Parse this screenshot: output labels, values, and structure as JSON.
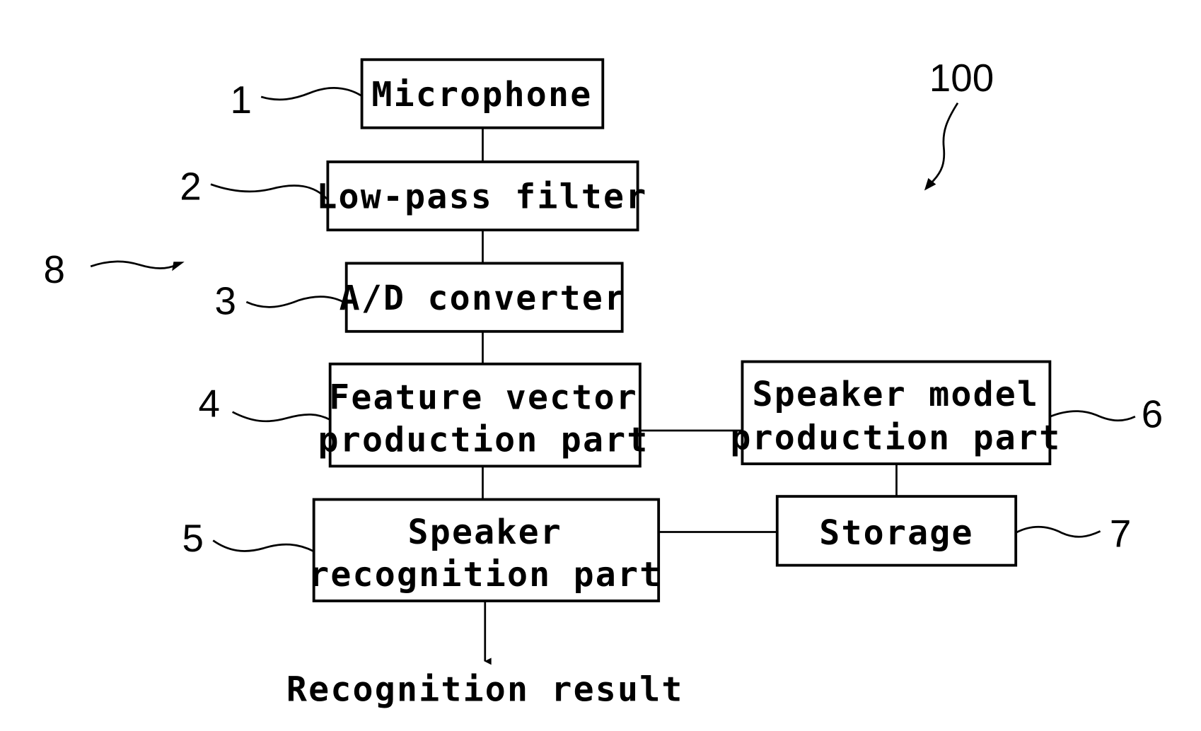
{
  "figure": {
    "reference_numeral": "100",
    "group_numeral": "8"
  },
  "blocks": {
    "microphone": {
      "numeral": "1",
      "lines": [
        "Microphone"
      ]
    },
    "low_pass_filter": {
      "numeral": "2",
      "lines": [
        "Low-pass filter"
      ]
    },
    "ad_converter": {
      "numeral": "3",
      "lines": [
        "A/D converter"
      ]
    },
    "feature_vector": {
      "numeral": "4",
      "lines": [
        "Feature vector",
        "production part"
      ]
    },
    "speaker_recognition": {
      "numeral": "5",
      "lines": [
        "Speaker",
        "recognition part"
      ]
    },
    "speaker_model": {
      "numeral": "6",
      "lines": [
        "Speaker model",
        "production part"
      ]
    },
    "storage": {
      "numeral": "7",
      "lines": [
        "Storage"
      ]
    }
  },
  "output": {
    "label": "Recognition result"
  },
  "connections": [
    [
      "microphone",
      "low_pass_filter"
    ],
    [
      "low_pass_filter",
      "ad_converter"
    ],
    [
      "ad_converter",
      "feature_vector"
    ],
    [
      "feature_vector",
      "speaker_recognition"
    ],
    [
      "feature_vector",
      "speaker_model"
    ],
    [
      "speaker_model",
      "storage"
    ],
    [
      "storage",
      "speaker_recognition"
    ],
    [
      "speaker_recognition",
      "output"
    ]
  ]
}
